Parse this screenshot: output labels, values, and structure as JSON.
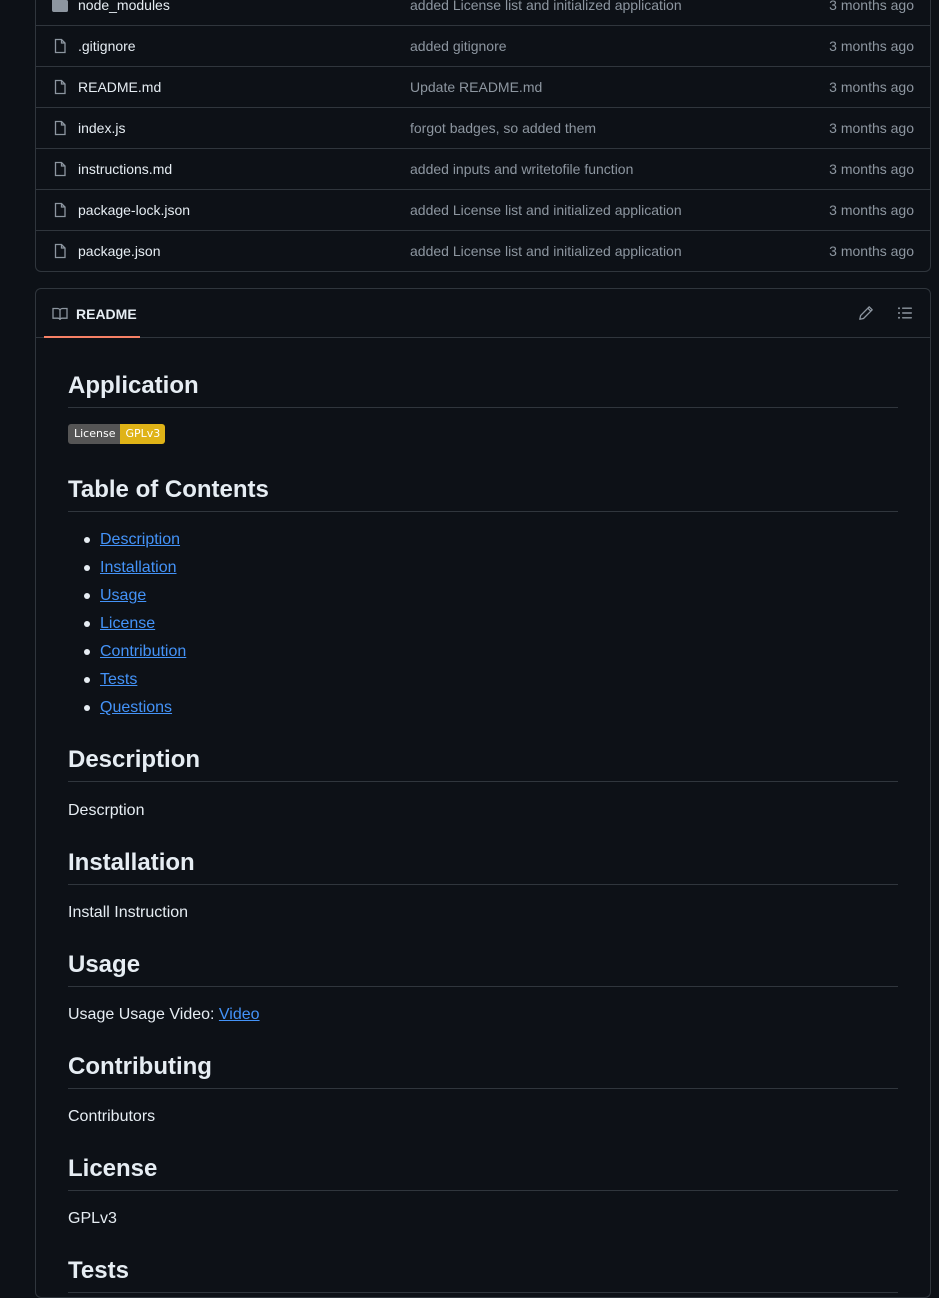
{
  "files": [
    {
      "name": "node_modules",
      "type": "folder",
      "commit": "added License list and initialized application",
      "age": "3 months ago"
    },
    {
      "name": ".gitignore",
      "type": "file",
      "commit": "added gitignore",
      "age": "3 months ago"
    },
    {
      "name": "README.md",
      "type": "file",
      "commit": "Update README.md",
      "age": "3 months ago"
    },
    {
      "name": "index.js",
      "type": "file",
      "commit": "forgot badges, so added them",
      "age": "3 months ago"
    },
    {
      "name": "instructions.md",
      "type": "file",
      "commit": "added inputs and writetofile function",
      "age": "3 months ago"
    },
    {
      "name": "package-lock.json",
      "type": "file",
      "commit": "added License list and initialized application",
      "age": "3 months ago"
    },
    {
      "name": "package.json",
      "type": "file",
      "commit": "added License list and initialized application",
      "age": "3 months ago"
    }
  ],
  "readme": {
    "tab_label": "README",
    "edit_icon": "pencil-icon",
    "outline_icon": "list-unordered-icon",
    "title": "Application",
    "badge": {
      "label": "License",
      "value": "GPLv3",
      "color": "#dfb317"
    },
    "toc_heading": "Table of Contents",
    "toc": [
      "Description",
      "Installation",
      "Usage",
      "License",
      "Contribution",
      "Tests",
      "Questions"
    ],
    "sections": {
      "description": {
        "heading": "Description",
        "text": "Descrption"
      },
      "installation": {
        "heading": "Installation",
        "text": "Install Instruction"
      },
      "usage": {
        "heading": "Usage",
        "text": "Usage Usage Video: ",
        "link": "Video"
      },
      "contributing": {
        "heading": "Contributing",
        "text": "Contributors"
      },
      "license": {
        "heading": "License",
        "text": "GPLv3"
      },
      "tests": {
        "heading": "Tests"
      }
    }
  },
  "colors": {
    "background": "#0d1117",
    "border": "#30363d",
    "link": "#4493f8",
    "tab_underline": "#f78166",
    "muted": "#8d96a0"
  }
}
